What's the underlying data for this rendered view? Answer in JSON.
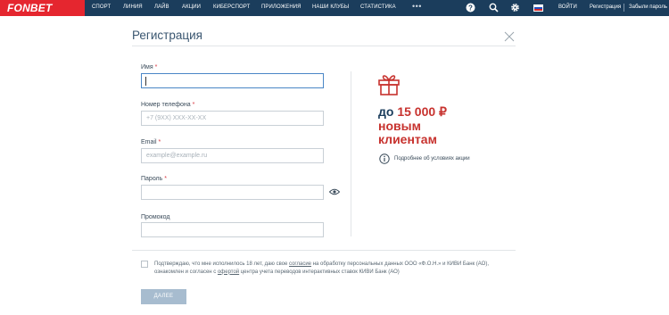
{
  "header": {
    "logo": "FONBET",
    "nav": [
      {
        "label": "СПОРТ"
      },
      {
        "label": "ЛИНИЯ"
      },
      {
        "label": "ЛАЙВ"
      },
      {
        "label": "АКЦИИ"
      },
      {
        "label": "КИБЕРСПОРТ"
      },
      {
        "label": "ПРИЛОЖЕНИЯ"
      },
      {
        "label": "НАШИ КЛУБЫ"
      },
      {
        "label": "СТАТИСТИКА"
      }
    ],
    "more": "•••",
    "login": "ВОЙТИ",
    "register": "Регистрация",
    "forgot_password": "Забыли пароль",
    "flag_colors": [
      "#ffffff",
      "#1f4fbf",
      "#d62828"
    ],
    "bar_color": "#1b3d5c",
    "logo_color": "#e5262f",
    "icons": [
      "help-icon",
      "search-icon",
      "gear-icon",
      "flag-ru-icon"
    ]
  },
  "form": {
    "title": "Регистрация",
    "fields": [
      {
        "label": "Имя",
        "required": "*",
        "placeholder": "",
        "value": ""
      },
      {
        "label": "Номер телефона",
        "required": "*",
        "placeholder": "+7 (9XX) XXX-XX-XX",
        "value": ""
      },
      {
        "label": "Email",
        "required": "*",
        "placeholder": "example@example.ru",
        "value": ""
      },
      {
        "label": "Пароль",
        "required": "*",
        "placeholder": "",
        "value": ""
      },
      {
        "label": "Промокод",
        "required": "",
        "placeholder": "",
        "value": ""
      }
    ],
    "consent": {
      "part1": "Подтверждаю, что мне исполнилось 18 лет, даю свое ",
      "link1": "согласие",
      "part2": " на обработку персональных данных ООО «Ф.О.Н.» и КИВИ Банк (АО), ознакомлен и согласен с ",
      "link2": "офертой",
      "part3": " центра учета переводов интерактивных ставок КИВИ Банк (АО)"
    },
    "submit": "ДАЛЕЕ"
  },
  "promo": {
    "prefix": "до",
    "amount": "15 000 ₽",
    "line2": "новым",
    "line3": "клиентам",
    "info": "Подробнее об условиях акции",
    "accent_color": "#c7322e"
  }
}
